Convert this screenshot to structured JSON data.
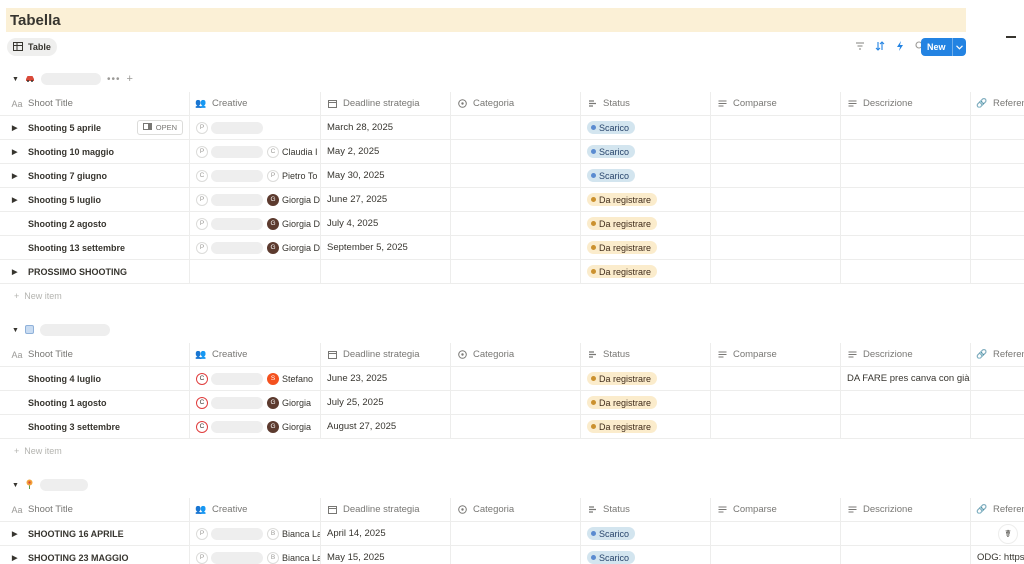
{
  "page": {
    "title": "Tabella",
    "view_tab": "Table"
  },
  "toolbar": {
    "icons": [
      "filter-icon",
      "sort-icon",
      "lightning-icon",
      "search-icon",
      "expand-icon",
      "settings-icon"
    ],
    "new_label": "New"
  },
  "colors": {
    "accent": "#2383e2",
    "title_bg": "#fbf0d6",
    "tag_blue": "#d3e5ef",
    "tag_yellow": "#fbeccc"
  },
  "columns": [
    "Shoot Title",
    "Creative",
    "Deadline strategia",
    "Categoria",
    "Status",
    "Comparse",
    "Descrizione",
    "Referen"
  ],
  "groups": [
    {
      "rows": [
        {
          "title": "Shooting 5 aprile",
          "expand": true,
          "open": "OPEN",
          "people": [
            {
              "init": "P",
              "name": "",
              "style": "light"
            }
          ],
          "deadline": "March 28, 2025",
          "status": "Scarico",
          "status_color": "blue",
          "descr": "",
          "ref": ""
        },
        {
          "title": "Shooting 10 maggio",
          "expand": true,
          "people": [
            {
              "init": "P",
              "name": "",
              "style": "light"
            },
            {
              "init": "C",
              "name": "Claudia I",
              "style": "light"
            }
          ],
          "deadline": "May 2, 2025",
          "status": "Scarico",
          "status_color": "blue",
          "descr": "",
          "ref": ""
        },
        {
          "title": "Shooting 7 giugno",
          "expand": true,
          "people": [
            {
              "init": "C",
              "name": "",
              "style": "light"
            },
            {
              "init": "P",
              "name": "Pietro To",
              "style": "light"
            }
          ],
          "deadline": "May 30, 2025",
          "status": "Scarico",
          "status_color": "blue",
          "descr": "",
          "ref": ""
        },
        {
          "title": "Shooting 5 luglio",
          "expand": true,
          "people": [
            {
              "init": "P",
              "name": "",
              "style": "light"
            },
            {
              "init": "G",
              "name": "Giorgia D",
              "style": "dark"
            }
          ],
          "deadline": "June 27, 2025",
          "status": "Da registrare",
          "status_color": "yellow",
          "descr": "",
          "ref": ""
        },
        {
          "title": "Shooting 2 agosto",
          "expand": false,
          "people": [
            {
              "init": "P",
              "name": "",
              "style": "light"
            },
            {
              "init": "G",
              "name": "Giorgia D",
              "style": "dark"
            }
          ],
          "deadline": "July 4, 2025",
          "status": "Da registrare",
          "status_color": "yellow",
          "descr": "",
          "ref": ""
        },
        {
          "title": "Shooting 13 settembre",
          "expand": false,
          "people": [
            {
              "init": "P",
              "name": "",
              "style": "light"
            },
            {
              "init": "G",
              "name": "Giorgia D",
              "style": "dark"
            }
          ],
          "deadline": "September 5, 2025",
          "status": "Da registrare",
          "status_color": "yellow",
          "descr": "",
          "ref": ""
        },
        {
          "title": "PROSSIMO SHOOTING",
          "expand": true,
          "people": [],
          "deadline": "",
          "status": "Da registrare",
          "status_color": "yellow",
          "descr": "",
          "ref": ""
        }
      ],
      "new_item": "New item"
    },
    {
      "rows": [
        {
          "title": "Shooting 4 luglio",
          "expand": false,
          "people": [
            {
              "init": "C",
              "name": "",
              "style": "ring"
            },
            {
              "init": "S",
              "name": "Stefano",
              "style": "orange"
            }
          ],
          "deadline": "June 23, 2025",
          "status": "Da registrare",
          "status_color": "yellow",
          "descr": "DA FARE pres canva con già qua",
          "ref": ""
        },
        {
          "title": "Shooting 1 agosto",
          "expand": false,
          "people": [
            {
              "init": "C",
              "name": "",
              "style": "ring"
            },
            {
              "init": "G",
              "name": "Giorgia",
              "style": "dark"
            }
          ],
          "deadline": "July 25, 2025",
          "status": "Da registrare",
          "status_color": "yellow",
          "descr": "",
          "ref": ""
        },
        {
          "title": "Shooting 3 settembre",
          "expand": false,
          "people": [
            {
              "init": "C",
              "name": "",
              "style": "ring"
            },
            {
              "init": "G",
              "name": "Giorgia",
              "style": "dark"
            }
          ],
          "deadline": "August 27, 2025",
          "status": "Da registrare",
          "status_color": "yellow",
          "descr": "",
          "ref": ""
        }
      ],
      "new_item": "New item"
    },
    {
      "rows": [
        {
          "title": "SHOOTING 16 APRILE",
          "expand": true,
          "people": [
            {
              "init": "P",
              "name": "",
              "style": "light"
            },
            {
              "init": "B",
              "name": "Bianca La",
              "style": "light"
            }
          ],
          "deadline": "April 14, 2025",
          "status": "Scarico",
          "status_color": "blue",
          "descr": "",
          "ref": ""
        },
        {
          "title": "SHOOTING 23 MAGGIO",
          "expand": true,
          "people": [
            {
              "init": "P",
              "name": "",
              "style": "light"
            },
            {
              "init": "B",
              "name": "Bianca La",
              "style": "light"
            }
          ],
          "deadline": "May 15, 2025",
          "status": "Scarico",
          "status_color": "blue",
          "descr": "",
          "ref": "ODG: https:"
        }
      ],
      "new_item": ""
    }
  ]
}
